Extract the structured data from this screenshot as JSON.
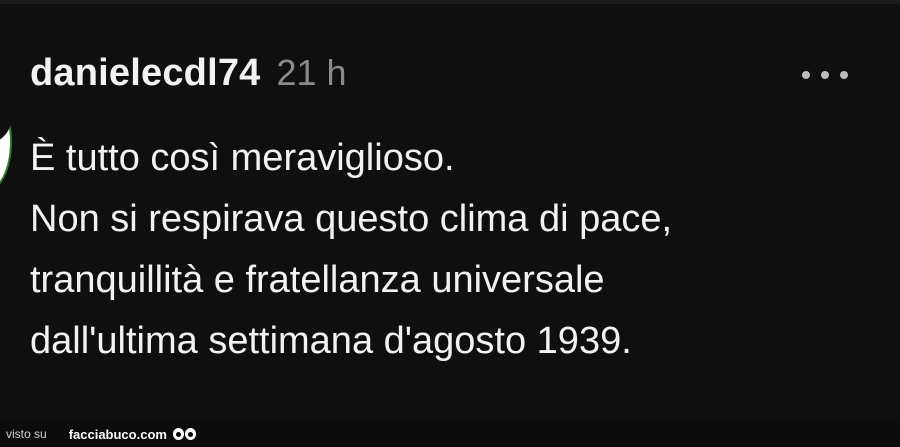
{
  "comment": {
    "username": "danielecdl74",
    "timestamp": "21 h",
    "more_icon": "more-horizontal-icon",
    "lines": [
      "È tutto così meraviglioso.",
      "Non si respirava questo clima di pace,",
      "tranquillità e fratellanza universale",
      "dall'ultima settimana d'agosto 1939."
    ]
  },
  "footer": {
    "prefix": "visto su",
    "site": "facciabuco.com",
    "logo_icon": "eyes-icon"
  },
  "colors": {
    "background": "#0f0f0f",
    "text": "#f2f2f2",
    "muted": "#8a8a8a"
  }
}
